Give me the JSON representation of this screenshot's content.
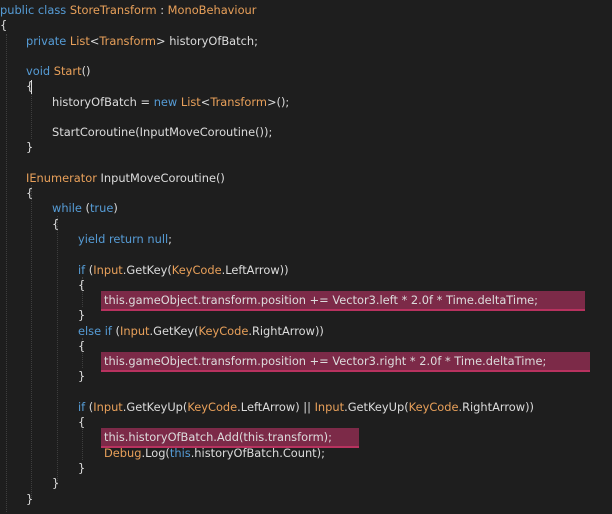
{
  "colors": {
    "background": "#1e1e1e",
    "text": "#dcdcdc",
    "keyword": "#569cd6",
    "type": "#e8a05a",
    "highlight": "#7c2a48",
    "highlight_underline": "#b8325f"
  },
  "code": {
    "language": "C#",
    "lines": [
      [
        {
          "t": "public",
          "c": "kw"
        },
        {
          "t": " "
        },
        {
          "t": "class",
          "c": "kw"
        },
        {
          "t": " "
        },
        {
          "t": "StoreTransform",
          "c": "ty"
        },
        {
          "t": " : "
        },
        {
          "t": "MonoBehaviour",
          "c": "ty"
        }
      ],
      [
        {
          "t": "{"
        }
      ],
      [
        {
          "t": "private",
          "c": "kw"
        },
        {
          "t": " "
        },
        {
          "t": "List",
          "c": "ty"
        },
        {
          "t": "<"
        },
        {
          "t": "Transform",
          "c": "ty"
        },
        {
          "t": "> historyOfBatch;"
        }
      ],
      [],
      [
        {
          "t": "void",
          "c": "kw"
        },
        {
          "t": " "
        },
        {
          "t": "Start",
          "c": "ty"
        },
        {
          "t": "()"
        }
      ],
      [
        {
          "t": "{"
        }
      ],
      [
        {
          "t": "historyOfBatch = "
        },
        {
          "t": "new",
          "c": "kw"
        },
        {
          "t": " "
        },
        {
          "t": "List",
          "c": "ty"
        },
        {
          "t": "<"
        },
        {
          "t": "Transform",
          "c": "ty"
        },
        {
          "t": ">();"
        }
      ],
      [],
      [
        {
          "t": "StartCoroutine(InputMoveCoroutine());"
        }
      ],
      [
        {
          "t": "}"
        }
      ],
      [],
      [
        {
          "t": "IEnumerator",
          "c": "ty"
        },
        {
          "t": " InputMoveCoroutine()"
        }
      ],
      [
        {
          "t": "{"
        }
      ],
      [
        {
          "t": "while",
          "c": "kw"
        },
        {
          "t": " ("
        },
        {
          "t": "true",
          "c": "kw"
        },
        {
          "t": ")"
        }
      ],
      [
        {
          "t": "{"
        }
      ],
      [
        {
          "t": "yield",
          "c": "kw"
        },
        {
          "t": " "
        },
        {
          "t": "return",
          "c": "kw"
        },
        {
          "t": " "
        },
        {
          "t": "null",
          "c": "kw"
        },
        {
          "t": ";"
        }
      ],
      [],
      [
        {
          "t": "if",
          "c": "kw"
        },
        {
          "t": " ("
        },
        {
          "t": "Input",
          "c": "ty"
        },
        {
          "t": ".GetKey("
        },
        {
          "t": "KeyCode",
          "c": "ty"
        },
        {
          "t": ".LeftArrow))"
        }
      ],
      [
        {
          "t": "{"
        }
      ],
      [
        {
          "t": "this.gameObject.transform.position += Vector3.left * 2.0f * Time.deltaTime;"
        }
      ],
      [
        {
          "t": "}"
        }
      ],
      [
        {
          "t": "else",
          "c": "kw"
        },
        {
          "t": " "
        },
        {
          "t": "if",
          "c": "kw"
        },
        {
          "t": " ("
        },
        {
          "t": "Input",
          "c": "ty"
        },
        {
          "t": ".GetKey("
        },
        {
          "t": "KeyCode",
          "c": "ty"
        },
        {
          "t": ".RightArrow))"
        }
      ],
      [
        {
          "t": "{"
        }
      ],
      [
        {
          "t": "this.gameObject.transform.position += Vector3.right * 2.0f * Time.deltaTime;"
        }
      ],
      [
        {
          "t": "}"
        }
      ],
      [],
      [
        {
          "t": "if",
          "c": "kw"
        },
        {
          "t": " ("
        },
        {
          "t": "Input",
          "c": "ty"
        },
        {
          "t": ".GetKeyUp("
        },
        {
          "t": "KeyCode",
          "c": "ty"
        },
        {
          "t": ".LeftArrow) || "
        },
        {
          "t": "Input",
          "c": "ty"
        },
        {
          "t": ".GetKeyUp("
        },
        {
          "t": "KeyCode",
          "c": "ty"
        },
        {
          "t": ".RightArrow))"
        }
      ],
      [
        {
          "t": "{"
        }
      ],
      [
        {
          "t": "this.historyOfBatch.Add(this.transform);"
        }
      ],
      [
        {
          "t": "Debug",
          "c": "ty"
        },
        {
          "t": ".Log("
        },
        {
          "t": "this",
          "c": "kw"
        },
        {
          "t": ".historyOfBatch.Count);"
        }
      ],
      [
        {
          "t": "}"
        }
      ],
      [
        {
          "t": "}"
        }
      ],
      [
        {
          "t": "}"
        }
      ]
    ],
    "highlighted_lines": [
      19,
      23,
      28
    ]
  }
}
